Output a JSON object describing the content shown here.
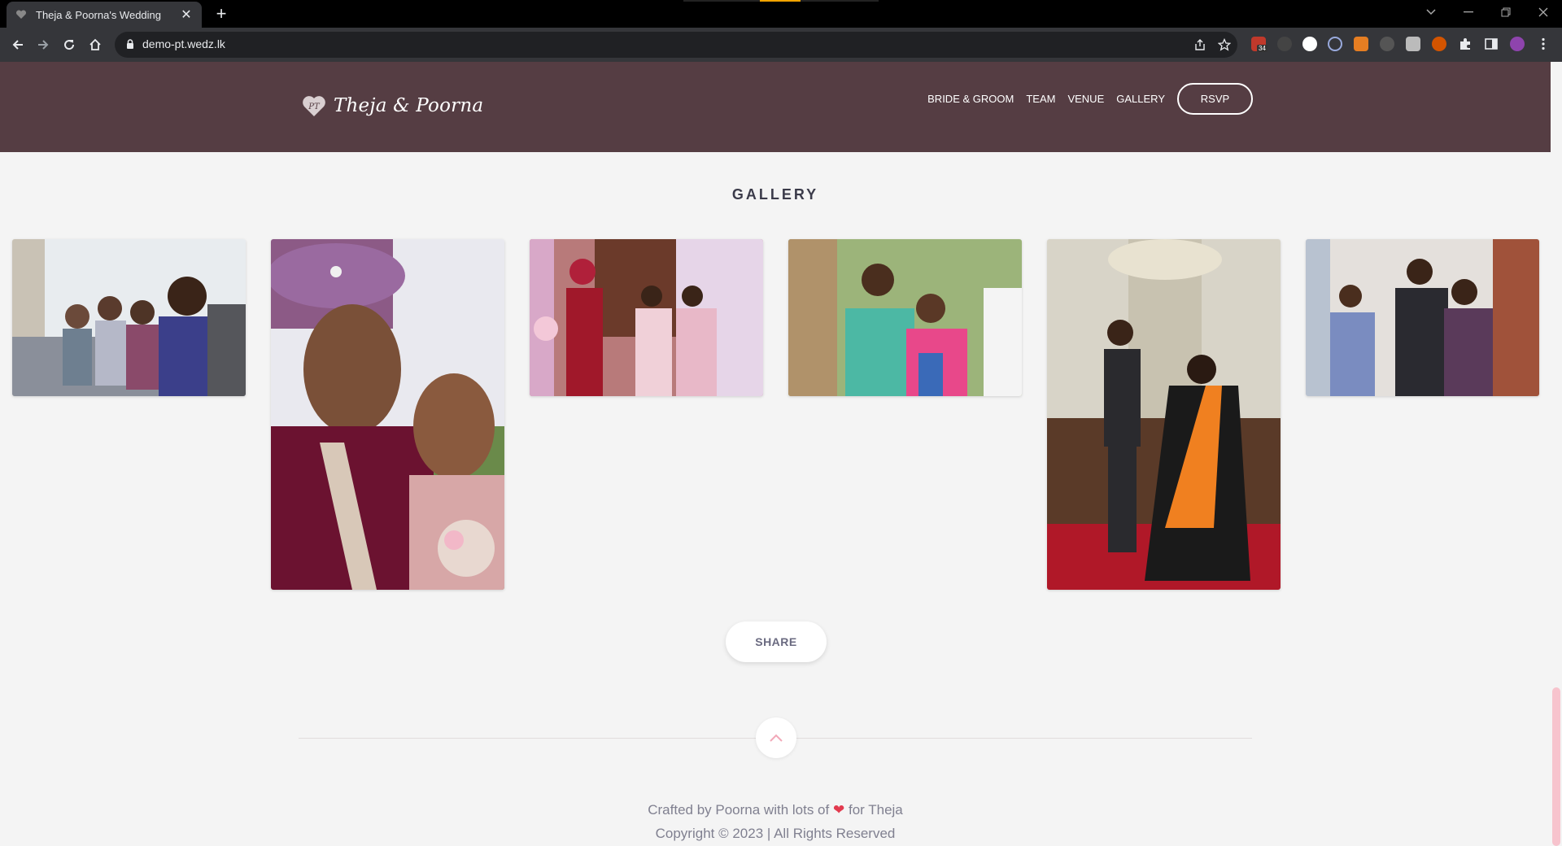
{
  "browser": {
    "tab_title": "Theja & Poorna's Wedding",
    "tab_close": "✕",
    "new_tab": "+",
    "url": "demo-pt.wedz.lk",
    "extension_badge": "34",
    "icons": [
      "back-icon",
      "forward-icon",
      "reload-icon",
      "home-icon",
      "lock-icon",
      "share-icon",
      "star-icon",
      "puzzle-icon",
      "sidepanel-icon",
      "menu-icon"
    ]
  },
  "site": {
    "brand": "Theja & Poorna",
    "nav": [
      "BRIDE & GROOM",
      "TEAM",
      "VENUE",
      "GALLERY"
    ],
    "rsvp": "RSVP"
  },
  "gallery": {
    "title": "GALLERY",
    "share_label": "SHARE"
  },
  "footer": {
    "crafted_prefix": "Crafted by Poorna with lots of",
    "heart": "❤",
    "crafted_suffix": "for Theja",
    "copyright": "Copyright © 2023 | All Rights Reserved"
  },
  "colors": {
    "header_bg": "#553d43",
    "page_bg": "#f4f4f4",
    "accent_pink": "#f7c3cd",
    "heart": "#e23a4e"
  }
}
